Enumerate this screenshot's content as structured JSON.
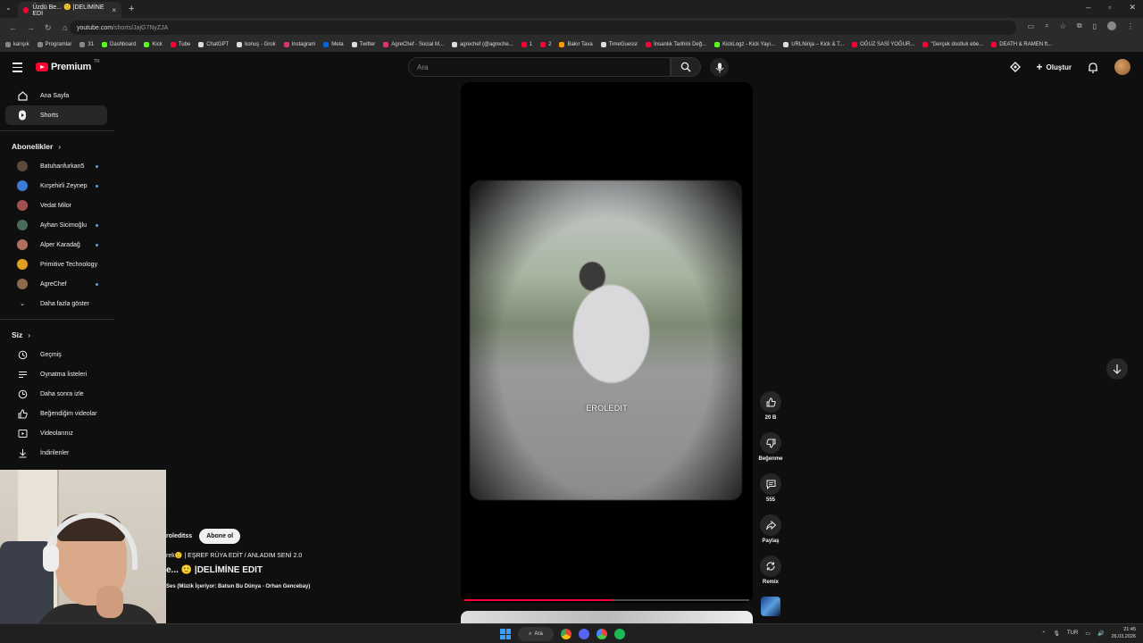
{
  "browser": {
    "tab_title": "Üzdü Be... 🙂 |DELİMİNE EDİ",
    "url_host": "youtube.com",
    "url_path": "/shorts/JajG7NyZJA",
    "bookmarks": [
      {
        "label": "karışık",
        "color": "#888"
      },
      {
        "label": "Programlar",
        "color": "#888"
      },
      {
        "label": "31",
        "color": "#888"
      },
      {
        "label": "Dashboard",
        "color": "#53fc18"
      },
      {
        "label": "Kick",
        "color": "#53fc18"
      },
      {
        "label": "Tube",
        "color": "#ff0033"
      },
      {
        "label": "ChatGPT",
        "color": "#ddd"
      },
      {
        "label": "konuş - Grok",
        "color": "#ddd"
      },
      {
        "label": "Instagram",
        "color": "#e1306c"
      },
      {
        "label": "Meta",
        "color": "#0668e1"
      },
      {
        "label": "Twitter",
        "color": "#ddd"
      },
      {
        "label": "AgreChef - Social M...",
        "color": "#e1306c"
      },
      {
        "label": "agrechef (@agreche...",
        "color": "#ddd"
      },
      {
        "label": "1",
        "color": "#ff0033"
      },
      {
        "label": "2",
        "color": "#ff0033"
      },
      {
        "label": "Bakır Tava",
        "color": "#ff9900"
      },
      {
        "label": "TimeGuessr",
        "color": "#ddd"
      },
      {
        "label": "İnsanlık Tarihini Değ...",
        "color": "#ff0033"
      },
      {
        "label": "KickLogz - Kick Yayı...",
        "color": "#53fc18"
      },
      {
        "label": "URLNinja – Kick & T...",
        "color": "#ddd"
      },
      {
        "label": "OĞUZ SASİ YOĞUR...",
        "color": "#ff0033"
      },
      {
        "label": "\"Gerçek dostluk ebe...",
        "color": "#ff0033"
      },
      {
        "label": "DEATH & RAMEN ft...",
        "color": "#ff0033"
      }
    ]
  },
  "header": {
    "logo_text": "Premium",
    "logo_region": "TR",
    "search_placeholder": "Ara",
    "create_label": "Oluştur"
  },
  "sidebar": {
    "main": [
      {
        "label": "Ana Sayfa",
        "icon": "home-icon"
      },
      {
        "label": "Shorts",
        "icon": "shorts-icon"
      }
    ],
    "subscriptions_title": "Abonelikler",
    "subscriptions": [
      {
        "label": "Batuhanfurkan5",
        "color": "#5b4a3a",
        "live": true
      },
      {
        "label": "Kırşehirli Zeynep",
        "color": "#3a7bd5",
        "live": true
      },
      {
        "label": "Vedat Milor",
        "color": "#a05050",
        "live": false
      },
      {
        "label": "Ayhan Sicimoğlu",
        "color": "#4a6a5a",
        "live": true
      },
      {
        "label": "Alper Karadağ",
        "color": "#b07060",
        "live": true
      },
      {
        "label": "Primitive Technology",
        "color": "#e0a020",
        "live": false
      },
      {
        "label": "AgreChef",
        "color": "#8a6a4a",
        "live": true
      }
    ],
    "show_more": "Daha fazla göster",
    "you_title": "Siz",
    "you_items": [
      {
        "label": "Geçmiş",
        "icon": "history-icon"
      },
      {
        "label": "Oynatma listeleri",
        "icon": "playlist-icon"
      },
      {
        "label": "Daha sonra izle",
        "icon": "clock-icon"
      },
      {
        "label": "Beğendiğim videolar",
        "icon": "like-icon"
      },
      {
        "label": "Videolarınız",
        "icon": "video-icon"
      },
      {
        "label": "İndirilenler",
        "icon": "download-icon"
      }
    ]
  },
  "video": {
    "watermark": "EROLEDIT",
    "progress": 0.52
  },
  "overlay": {
    "channel": "roleditss",
    "subscribe": "Abone ol",
    "playlist": "rek🙂 | EŞREF RÜYA EDİT / ANLADIM SENİ 2.0",
    "title": "e... 🙂 |DELİMİNE EDIT",
    "music": "Ses (Müzik İçeriyor: Batsın Bu Dünya - Orhan Gencebay)"
  },
  "actions": {
    "likes": "20 B",
    "dislike": "Beğenme",
    "comments": "555",
    "share": "Paylaş",
    "remix": "Remix"
  },
  "taskbar": {
    "search": "Ara",
    "lang": "TUR",
    "time": "21:45",
    "date": "26.03.2026"
  }
}
